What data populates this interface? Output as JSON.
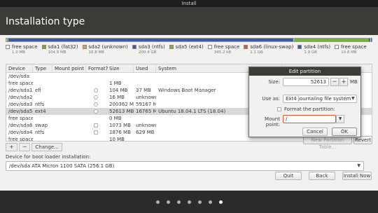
{
  "window": {
    "title": "Install"
  },
  "header": {
    "title": "Installation type"
  },
  "disk_bar": {
    "segments": [
      {
        "color": "#d0d0d0",
        "fraction": 0.002
      },
      {
        "color": "#7fa53b",
        "fraction": 0.0003
      },
      {
        "color": "#d8a15b",
        "fraction": 0.0001
      },
      {
        "color": "#3a5d9c",
        "fraction": 0.783
      },
      {
        "color": "#d0d0d0",
        "fraction": 0.001
      },
      {
        "color": "#73b33e",
        "fraction": 0.206
      },
      {
        "color": "#3a5d9c",
        "fraction": 0.004
      },
      {
        "color": "#dfe6ef",
        "fraction": 0.001
      },
      {
        "color": "#3a5d9c",
        "fraction": 0.002
      }
    ]
  },
  "legend": [
    {
      "name": "free space",
      "size": "1.0 MB",
      "color": "#ffffff"
    },
    {
      "name": "sda1 (fat32)",
      "size": "104.9 MB",
      "color": "#7fa53b"
    },
    {
      "name": "sda2 (unknown)",
      "size": "16.8 MB",
      "color": "#d8a15b"
    },
    {
      "name": "sda3 (ntfs)",
      "size": "200.4 GB",
      "color": "#3a5d9c"
    },
    {
      "name": "sda5 (ext4)",
      "size": "",
      "color": "#73b33e"
    },
    {
      "name": "free space",
      "size": "345.2 kB",
      "color": "#ffffff"
    },
    {
      "name": "sda6 (linux-swap)",
      "size": "1.1 GB",
      "color": "#d55a3c"
    },
    {
      "name": "sda4 (ntfs)",
      "size": "1.9 GB",
      "color": "#3a5d9c"
    },
    {
      "name": "free space",
      "size": "10.8 MB",
      "color": "#ffffff"
    }
  ],
  "table": {
    "headers": [
      "Device",
      "Type",
      "Mount point",
      "Format?",
      "Size",
      "Used",
      "System"
    ],
    "rows": [
      {
        "device": "/dev/sda",
        "type": "",
        "mount": "",
        "format": "",
        "size": "",
        "used": "",
        "system": ""
      },
      {
        "device": "free space",
        "type": "",
        "mount": "",
        "format": "",
        "size": "1 MB",
        "used": "",
        "system": ""
      },
      {
        "device": "/dev/sda1",
        "type": "efi",
        "mount": "",
        "format": "radio",
        "size": "104 MB",
        "used": "37 MB",
        "system": "Windows Boot Manager"
      },
      {
        "device": "/dev/sda2",
        "type": "",
        "mount": "",
        "format": "radio",
        "size": "16 MB",
        "used": "unknown",
        "system": ""
      },
      {
        "device": "/dev/sda3",
        "type": "ntfs",
        "mount": "",
        "format": "radio",
        "size": "200362 MB",
        "used": "59167 MB",
        "system": ""
      },
      {
        "device": "/dev/sda5",
        "type": "ext4",
        "mount": "",
        "format": "radio",
        "size": "52613 MB",
        "used": "16765 MB",
        "system": "Ubuntu 18.04.1 LTS (18.04)"
      },
      {
        "device": "free space",
        "type": "",
        "mount": "",
        "format": "",
        "size": "0 MB",
        "used": "",
        "system": ""
      },
      {
        "device": "/dev/sda6",
        "type": "swap",
        "mount": "",
        "format": "check",
        "size": "1073 MB",
        "used": "unknown",
        "system": ""
      },
      {
        "device": "/dev/sda4",
        "type": "ntfs",
        "mount": "",
        "format": "check",
        "size": "1876 MB",
        "used": "629 MB",
        "system": ""
      },
      {
        "device": "free space",
        "type": "",
        "mount": "",
        "format": "",
        "size": "10 MB",
        "used": "",
        "system": ""
      }
    ],
    "selected_row": 5
  },
  "table_buttons": {
    "add": "+",
    "remove": "−",
    "change": "Change..."
  },
  "new_partition_table_label": "New Partition Table...",
  "revert_label": "Revert",
  "boot_loader": {
    "label": "Device for boot loader installation:",
    "value": "/dev/sda   ATA Micron 1100 SATA (256.1 GB)"
  },
  "nav": {
    "quit": "Quit",
    "back": "Back",
    "install_now": "Install Now"
  },
  "pager": {
    "total": 7,
    "active": 6
  },
  "dialog": {
    "title": "Edit partition",
    "size_label": "Size:",
    "size_value": "52613",
    "size_unit": "MB",
    "minus": "−",
    "plus": "+",
    "use_as_label": "Use as:",
    "use_as_value": "Ext4 journaling file system",
    "format_label": "Format the partition:",
    "mount_label": "Mount point:",
    "mount_value": "/",
    "cancel": "Cancel",
    "ok": "OK"
  }
}
